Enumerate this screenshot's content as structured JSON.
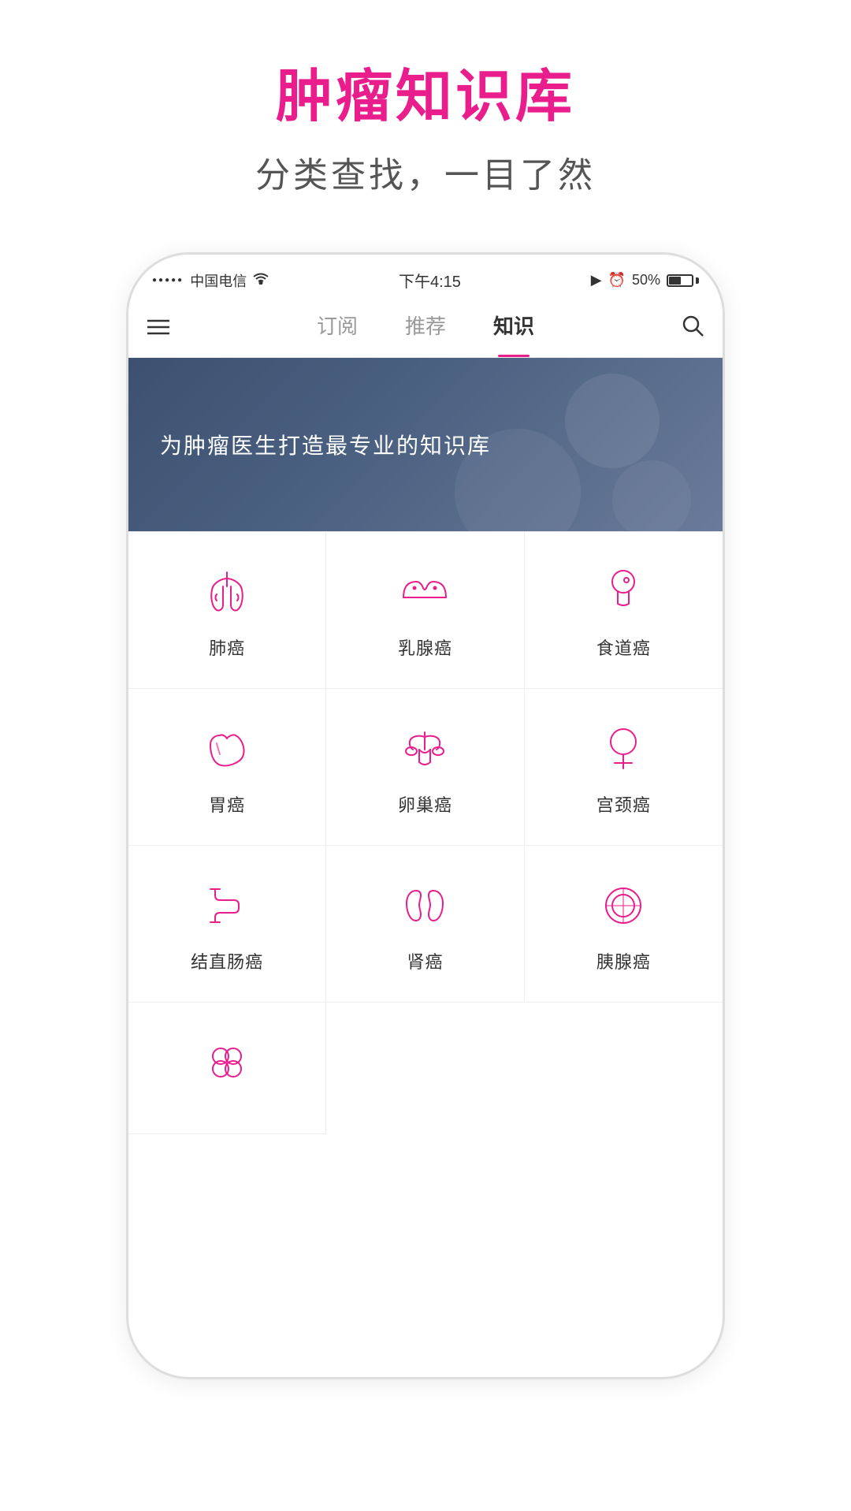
{
  "header": {
    "title": "肿瘤知识库",
    "subtitle": "分类查找，一目了然"
  },
  "statusBar": {
    "carrier": "中国电信",
    "time": "下午4:15",
    "battery": "50%"
  },
  "navBar": {
    "tabs": [
      {
        "label": "订阅",
        "active": false
      },
      {
        "label": "推荐",
        "active": false
      },
      {
        "label": "知识",
        "active": true
      }
    ]
  },
  "banner": {
    "text": "为肿瘤医生打造最专业的知识库"
  },
  "cancerTypes": [
    {
      "id": "lung",
      "label": "肺癌",
      "icon": "lung"
    },
    {
      "id": "breast",
      "label": "乳腺癌",
      "icon": "breast"
    },
    {
      "id": "esophagus",
      "label": "食道癌",
      "icon": "esophagus"
    },
    {
      "id": "stomach",
      "label": "胃癌",
      "icon": "stomach"
    },
    {
      "id": "ovary",
      "label": "卵巢癌",
      "icon": "ovary"
    },
    {
      "id": "cervix",
      "label": "宫颈癌",
      "icon": "cervix"
    },
    {
      "id": "colon",
      "label": "结直肠癌",
      "icon": "colon"
    },
    {
      "id": "kidney",
      "label": "肾癌",
      "icon": "kidney"
    },
    {
      "id": "pancreas",
      "label": "胰腺癌",
      "icon": "pancreas"
    },
    {
      "id": "misc",
      "label": "",
      "icon": "misc"
    }
  ]
}
